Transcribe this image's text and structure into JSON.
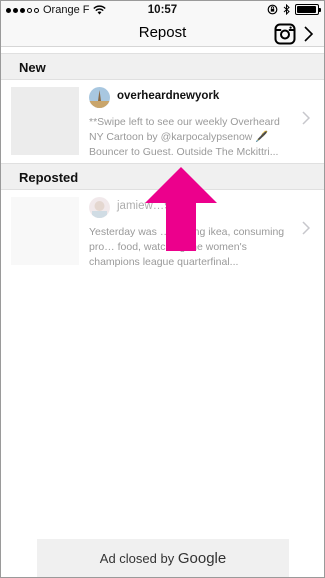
{
  "status_bar": {
    "carrier": "Orange F",
    "time": "10:57",
    "battery_level": 0.95
  },
  "nav": {
    "title": "Repost",
    "instagram_icon": "instagram-icon",
    "forward_icon": "chevron-right-icon"
  },
  "sections": {
    "new": {
      "header": "New",
      "post": {
        "username": "overheardnewyork",
        "caption": "**Swipe left to see our weekly Overheard NY Cartoon by @karpocalypsenow 🖋️ Bouncer to Guest. Outside The Mckittri..."
      }
    },
    "reposted": {
      "header": "Reposted",
      "post": {
        "username": "jamiew…92",
        "caption": "Yesterday was … visiting ikea, consuming pro… food, watching the women's champions league quarterfinal..."
      }
    }
  },
  "ad": {
    "prefix": "Ad closed by",
    "brand": "Google"
  },
  "colors": {
    "arrow": "#ec008c",
    "section_bg": "#f0f0f0",
    "caption": "#9a9a9a"
  }
}
